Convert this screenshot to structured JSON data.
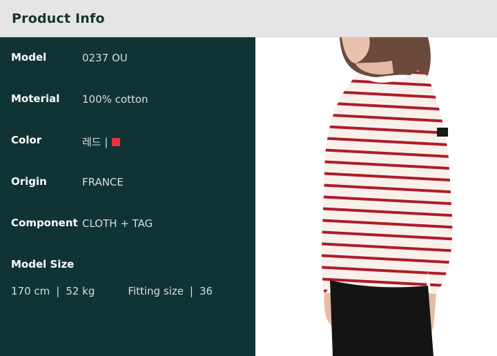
{
  "header": {
    "title": "Product Info"
  },
  "specs": [
    {
      "label": "Model",
      "value": "0237 OU"
    },
    {
      "label": "Moterial",
      "value": "100% cotton"
    },
    {
      "label": "Color",
      "value": "레드 |"
    },
    {
      "label": "Origin",
      "value": "FRANCE"
    },
    {
      "label": "Component",
      "value": "CLOTH + TAG"
    }
  ],
  "color_swatch": "#e8323f",
  "model_size": {
    "label": "Model Size",
    "height": "170 cm",
    "weight": "52 kg",
    "separator": "|",
    "fitting_label": "Fitting size",
    "fitting_value": "36"
  },
  "product_image": {
    "icon": "striped-shirt-photo",
    "stripe_color": "#b01a2a",
    "base_color": "#f6f1ea"
  }
}
